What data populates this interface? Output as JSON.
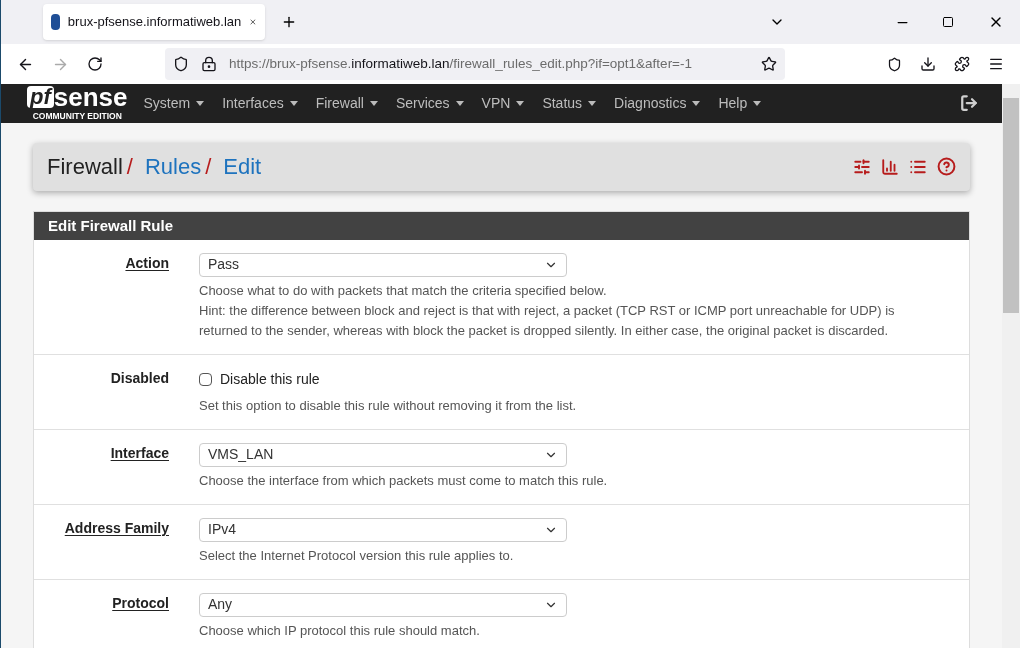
{
  "browser": {
    "tab_title": "brux-pfsense.informatiweb.lan",
    "url": {
      "prefix": "https://brux-pfsense.",
      "host": "informatiweb.lan",
      "path": "/firewall_rules_edit.php?if=opt1&after=-1"
    }
  },
  "logo": {
    "mark": "pf",
    "word": "sense",
    "edition": "COMMUNITY EDITION"
  },
  "nav": [
    "System",
    "Interfaces",
    "Firewall",
    "Services",
    "VPN",
    "Status",
    "Diagnostics",
    "Help"
  ],
  "breadcrumb": [
    {
      "label": "Firewall",
      "link": false,
      "separator": "/"
    },
    {
      "label": "Rules",
      "link": true,
      "separator": "/"
    },
    {
      "label": "Edit",
      "link": true
    }
  ],
  "panel": {
    "title": "Edit Firewall Rule"
  },
  "rows": [
    {
      "label": "Action",
      "link": true,
      "kind": "select",
      "value": "Pass",
      "help": [
        "Choose what to do with packets that match the criteria specified below.",
        "Hint: the difference between block and reject is that with reject, a packet (TCP RST or ICMP port unreachable for UDP) is returned to the sender, whereas with block the packet is dropped silently. In either case, the original packet is discarded."
      ]
    },
    {
      "label": "Disabled",
      "link": false,
      "kind": "checkbox",
      "checked": false,
      "option": "Disable this rule",
      "help": [
        "Set this option to disable this rule without removing it from the list."
      ]
    },
    {
      "label": "Interface",
      "link": true,
      "kind": "select",
      "value": "VMS_LAN",
      "help": [
        "Choose the interface from which packets must come to match this rule."
      ]
    },
    {
      "label": "Address Family",
      "link": true,
      "kind": "select",
      "value": "IPv4",
      "help": [
        "Select the Internet Protocol version this rule applies to."
      ]
    },
    {
      "label": "Protocol",
      "link": true,
      "kind": "select",
      "value": "Any",
      "help": [
        "Choose which IP protocol this rule should match."
      ]
    }
  ]
}
